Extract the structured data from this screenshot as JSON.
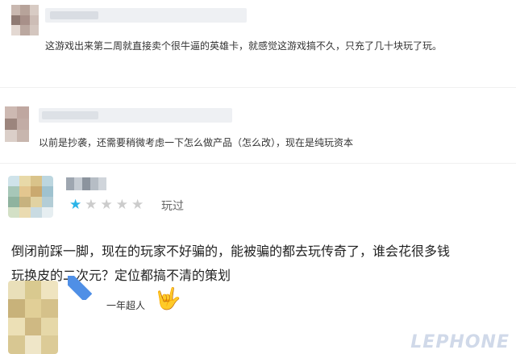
{
  "colors": {
    "star_filled": "#2bb4e8",
    "star_empty": "#cccccc",
    "badge": "#4f8fe6"
  },
  "comments": [
    {
      "text": "这游戏出来第二周就直接卖个很牛逼的英雄卡，就感觉这游戏搞不久，只充了几十块玩了玩。"
    },
    {
      "text": "以前是抄袭，还需要稍微考虑一下怎么做产品（怎么改），现在是纯玩资本"
    },
    {
      "rating": 1,
      "rating_max": 5,
      "status": "玩过",
      "text_line1": "倒闭前踩一脚，现在的玩家不好骗的，能被骗的都去玩传奇了，谁会花很多钱",
      "text_line2": "玩换皮的二次元？定位都搞不清的策划"
    },
    {
      "username": "一年超人",
      "emoji": "🤟"
    }
  ],
  "watermark": "LEPHONE"
}
